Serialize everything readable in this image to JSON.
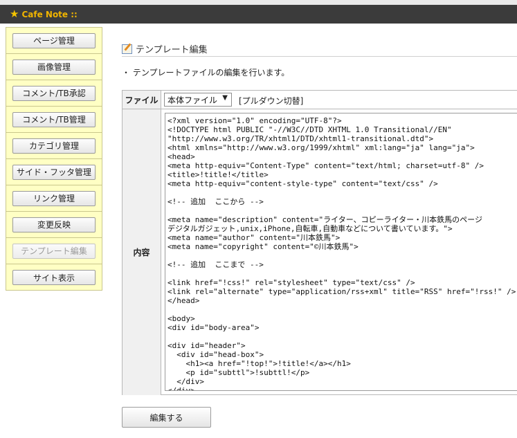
{
  "app": {
    "title": "Cafe Note ::"
  },
  "sidebar": {
    "items": [
      {
        "label": "ページ管理"
      },
      {
        "label": "画像管理"
      },
      {
        "label": "コメント/TB承認"
      },
      {
        "label": "コメント/TB管理"
      },
      {
        "label": "カテゴリ管理"
      },
      {
        "label": "サイド・フッタ管理"
      },
      {
        "label": "リンク管理"
      },
      {
        "label": "変更反映"
      },
      {
        "label": "テンプレート編集",
        "disabled": true
      },
      {
        "label": "サイト表示"
      }
    ]
  },
  "main": {
    "heading": "テンプレート編集",
    "description": "・ テンプレートファイルの編集を行います。",
    "file_label": "ファイル",
    "file_select_value": "本体ファイル",
    "file_hint": "[プルダウン切替]",
    "content_label": "内容",
    "template_code": "<?xml version=\"1.0\" encoding=\"UTF-8\"?>\n<!DOCTYPE html PUBLIC \"-//W3C//DTD XHTML 1.0 Transitional//EN\"\n\"http://www.w3.org/TR/xhtml1/DTD/xhtml1-transitional.dtd\">\n<html xmlns=\"http://www.w3.org/1999/xhtml\" xml:lang=\"ja\" lang=\"ja\">\n<head>\n<meta http-equiv=\"Content-Type\" content=\"text/html; charset=utf-8\" />\n<title>!title!</title>\n<meta http-equiv=\"content-style-type\" content=\"text/css\" />\n\n<!-- 追加  ここから -->\n\n<meta name=\"description\" content=\"ライター、コピーライター・川本鉄馬のページ\nデジタルガジェット,unix,iPhone,自転車,自動車などについて書いています。\">\n<meta name=\"author\" content=\"川本鉄馬\">\n<meta name=\"copyright\" content=\"©川本鉄馬\">\n\n<!-- 追加  ここまで -->\n\n<link href=\"!css!\" rel=\"stylesheet\" type=\"text/css\" />\n<link rel=\"alternate\" type=\"application/rss+xml\" title=\"RSS\" href=\"!rss!\" />\n</head>\n\n<body>\n<div id=\"body-area\">\n\n<div id=\"header\">\n  <div id=\"head-box\">\n    <h1><a href=\"!top!\">!title!</a></h1>\n    <p id=\"subttl\">!subttl!</p>\n  </div>\n</div>",
    "submit_label": "編集する"
  }
}
